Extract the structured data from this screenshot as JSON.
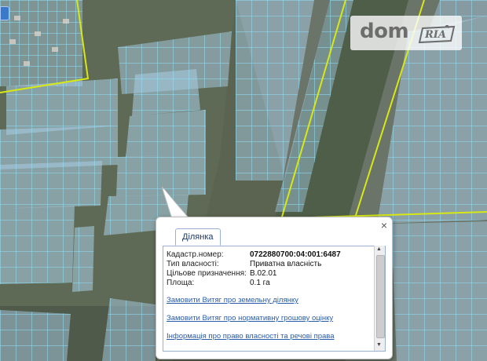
{
  "watermark": {
    "brand": "dom",
    "sub": "RIA"
  },
  "popup": {
    "tab_label": "Ділянка",
    "close_label": "×",
    "fields": [
      {
        "label": "Кадастр.номер:",
        "value": "0722880700:04:001:6487",
        "bold": true
      },
      {
        "label": "Тип власності:",
        "value": "Приватна власність",
        "bold": false
      },
      {
        "label": "Цільове призначення:",
        "value": "В.02.01",
        "bold": false
      },
      {
        "label": "Площа:",
        "value": "0.1 га",
        "bold": false
      }
    ],
    "links": [
      "Замовити Витяг про земельну ділянку",
      "Замовити Витяг про нормативну грошову оцінку",
      "Інформація про право власності та речові права"
    ]
  },
  "colors": {
    "parcel_fill": "#a9cde6",
    "parcel_stroke": "#7fdcff",
    "boundary": "#d8e814",
    "link": "#2a5ca8",
    "map_ground": "#4a5a40"
  }
}
